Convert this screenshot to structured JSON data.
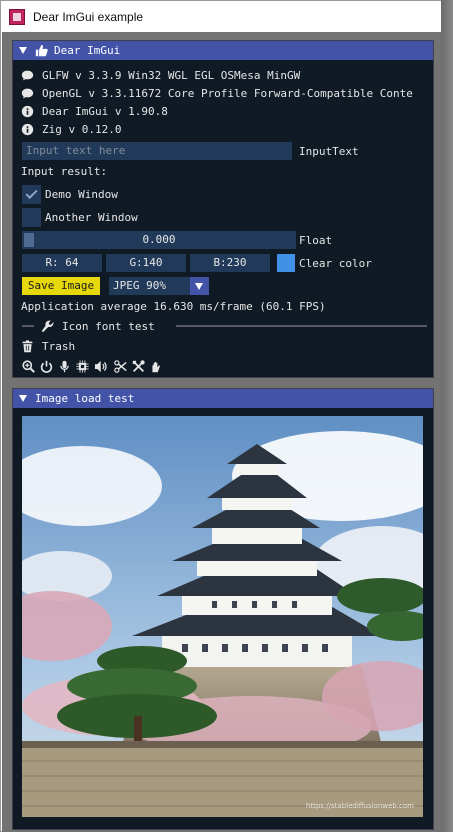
{
  "os_window": {
    "title": "Dear ImGui example"
  },
  "main_window": {
    "title": "Dear ImGui",
    "info": [
      {
        "icon": "comment-icon",
        "text": "GLFW v 3.3.9 Win32 WGL EGL OSMesa MinGW"
      },
      {
        "icon": "comment-icon",
        "text": "OpenGL v 3.3.11672 Core Profile Forward-Compatible Conte"
      },
      {
        "icon": "info-icon",
        "text": "Dear ImGui v 1.90.8"
      },
      {
        "icon": "info-icon",
        "text": "Zig v 0.12.0"
      }
    ],
    "input": {
      "placeholder": "Input text here",
      "label": "InputText"
    },
    "input_result_label": "Input result:",
    "demo_window": {
      "label": "Demo Window",
      "checked": true
    },
    "another_window": {
      "label": "Another Window",
      "checked": false
    },
    "float_slider": {
      "value": "0.000",
      "label": "Float",
      "fraction": 0.0
    },
    "clear_color": {
      "r": "R: 64",
      "g": "G:140",
      "b": "B:230",
      "label": "Clear color",
      "swatch": "#4090e6"
    },
    "save_button": "Save Image",
    "format_combo": "JPEG 90%",
    "fps_text": "Application average 16.630 ms/frame (60.1 FPS)",
    "icon_font_header": "Icon font test",
    "trash_label": "Trash",
    "icon_row": [
      "search-plus-icon",
      "power-icon",
      "microphone-icon",
      "microchip-icon",
      "volume-icon",
      "scissors-icon",
      "tools-icon",
      "hands-icon"
    ]
  },
  "image_window": {
    "title": "Image load test",
    "watermark": "https://stablediffusionweb.com"
  },
  "colors": {
    "title_bar": "#4354a8",
    "window_bg": "#0f1a25",
    "frame_bg": "#223a59",
    "accent_yellow": "#e6d80b"
  }
}
